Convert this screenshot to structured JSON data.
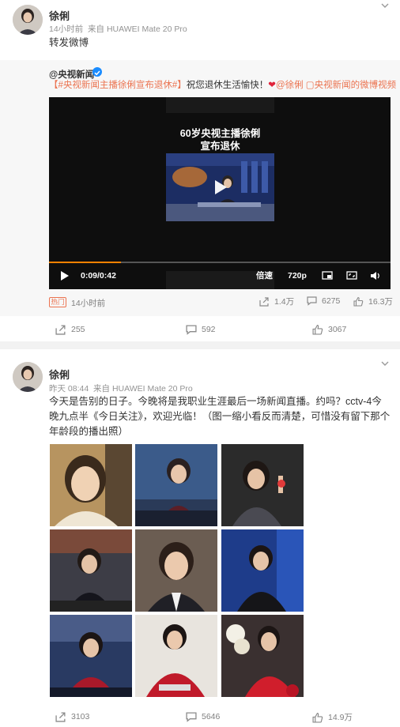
{
  "post1": {
    "author": "徐俐",
    "time": "14小时前",
    "source": "来自 HUAWEI Mate 20 Pro",
    "text": "转发微博",
    "repost": {
      "author": "@央视新闻",
      "text_tag": "【#央视新闻主播徐俐宣布退休#】",
      "text_mid": "祝您退休生活愉快！",
      "text_heart": "❤",
      "text_link": "@徐俐 ▢央视新闻的微博视频",
      "video": {
        "title_line1": "60岁央视主播徐俐",
        "title_line2": "宣布退休",
        "time": "0:09/0:42",
        "progress": 0.21,
        "speed_label": "倍速",
        "quality_label": "720p"
      },
      "hot_badge": "热门",
      "time": "14小时前",
      "reposts": "1.4万",
      "comments": "6275",
      "likes": "16.3万"
    },
    "actions": {
      "reposts": "255",
      "comments": "592",
      "likes": "3067"
    }
  },
  "post2": {
    "author": "徐俐",
    "time": "昨天 08:44",
    "source": "来自 HUAWEI Mate 20 Pro",
    "text": "今天是告别的日子。今晚将是我职业生涯最后一场新闻直播。约吗？cctv-4今晚九点半《今日关注》，欢迎光临！（图一缩小看反而清楚，可惜没有留下那个年龄段的播出照）",
    "actions": {
      "reposts": "3103",
      "comments": "5646",
      "likes": "14.9万"
    }
  },
  "colors": {
    "accent": "#eb7350",
    "verified": "#1a8cff",
    "progress": "#ff8200"
  }
}
